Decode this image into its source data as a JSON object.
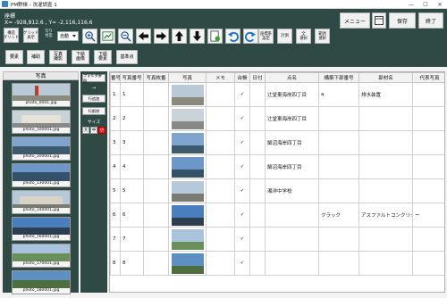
{
  "window": {
    "title": "PM野帳 - 洗濯調査 1",
    "min": "—",
    "max": "☐",
    "close": "✕"
  },
  "header": {
    "label": "座標",
    "coords": "X= -928,812.6 , Y= -2,116,116.6"
  },
  "toolbar": {
    "grid_btn": "構造\nグリッド",
    "grid_display_btn": "グリッド\n表示",
    "photo_attach_label": "写り\n付近",
    "auto_select": "自動",
    "icons": [
      "zoom-in",
      "zoom-fit",
      "zoom-out",
      "arrow-left",
      "arrow-right",
      "arrow-up",
      "arrow-down",
      "export",
      "undo",
      "redo"
    ],
    "coord_setting": "座標系\n設定",
    "measure": "計測",
    "select_all": "全\n選択",
    "range_select": "範囲\n選択"
  },
  "right_buttons": {
    "menu": "メニュー",
    "save": "保存",
    "exit": "終了"
  },
  "tabs": [
    {
      "label": "要素"
    },
    {
      "label": "補助"
    },
    {
      "label": "写真\n撮影"
    },
    {
      "label": "下絵\n画像"
    },
    {
      "label": "下絵\n要素"
    },
    {
      "label": "基準点"
    }
  ],
  "photo_panel": {
    "header": "写真",
    "thumbs": [
      {
        "caption": "photo_0001.jpg"
      },
      {
        "caption": "photo_100001.jpg"
      },
      {
        "caption": "photo_100001.jpg"
      },
      {
        "caption": "photo_130001.jpg"
      },
      {
        "caption": "photo_140001.jpg"
      },
      {
        "caption": "photo_160001.jpg"
      },
      {
        "caption": "photo_170001.jpg"
      },
      {
        "caption": "photo_180001.jpg"
      }
    ]
  },
  "controls": {
    "folder_btn": "フォルダ参照",
    "arrow": "→",
    "add_row": "行追加",
    "del_row": "行削除",
    "size_label": "サイズ",
    "sizes": [
      "大",
      "中",
      "小"
    ]
  },
  "grid": {
    "columns": [
      "番号",
      "写真番号",
      "写真枚番",
      "写真",
      "メモ",
      "台帳",
      "日付",
      "点名",
      "構築下部番号",
      "部材名",
      "代表写真"
    ],
    "rows": [
      {
        "no": "1",
        "photo_no": "1",
        "memo": "",
        "check": "✓",
        "name": "辻堂東海岸四丁目",
        "sub": "a",
        "member": "排水装置",
        "rep": ""
      },
      {
        "no": "2",
        "photo_no": "2",
        "memo": "",
        "check": "✓",
        "name": "辻堂東海岸四丁目",
        "sub": "",
        "member": "",
        "rep": ""
      },
      {
        "no": "3",
        "photo_no": "3",
        "memo": "",
        "check": "✓",
        "name": "鵠沼海岸四丁目",
        "sub": "",
        "member": "",
        "rep": ""
      },
      {
        "no": "4",
        "photo_no": "4",
        "memo": "",
        "check": "✓",
        "name": "鵠沼海岸四丁目",
        "sub": "",
        "member": "",
        "rep": ""
      },
      {
        "no": "5",
        "photo_no": "5",
        "memo": "",
        "check": "✓",
        "name": "湘洋中学校",
        "sub": "",
        "member": "",
        "rep": ""
      },
      {
        "no": "6",
        "photo_no": "6",
        "memo": "",
        "check": "✓",
        "name": "",
        "sub": "クラック",
        "member": "アスファルトコンクリート",
        "rep": "ー"
      },
      {
        "no": "7",
        "photo_no": "7",
        "memo": "",
        "check": "✓",
        "name": "",
        "sub": "",
        "member": "",
        "rep": ""
      },
      {
        "no": "8",
        "photo_no": "8",
        "memo": "",
        "check": "✓",
        "name": "",
        "sub": "",
        "member": "",
        "rep": ""
      }
    ]
  },
  "colors": {
    "panel": "#2f4a44",
    "highlight": "#e02020"
  }
}
